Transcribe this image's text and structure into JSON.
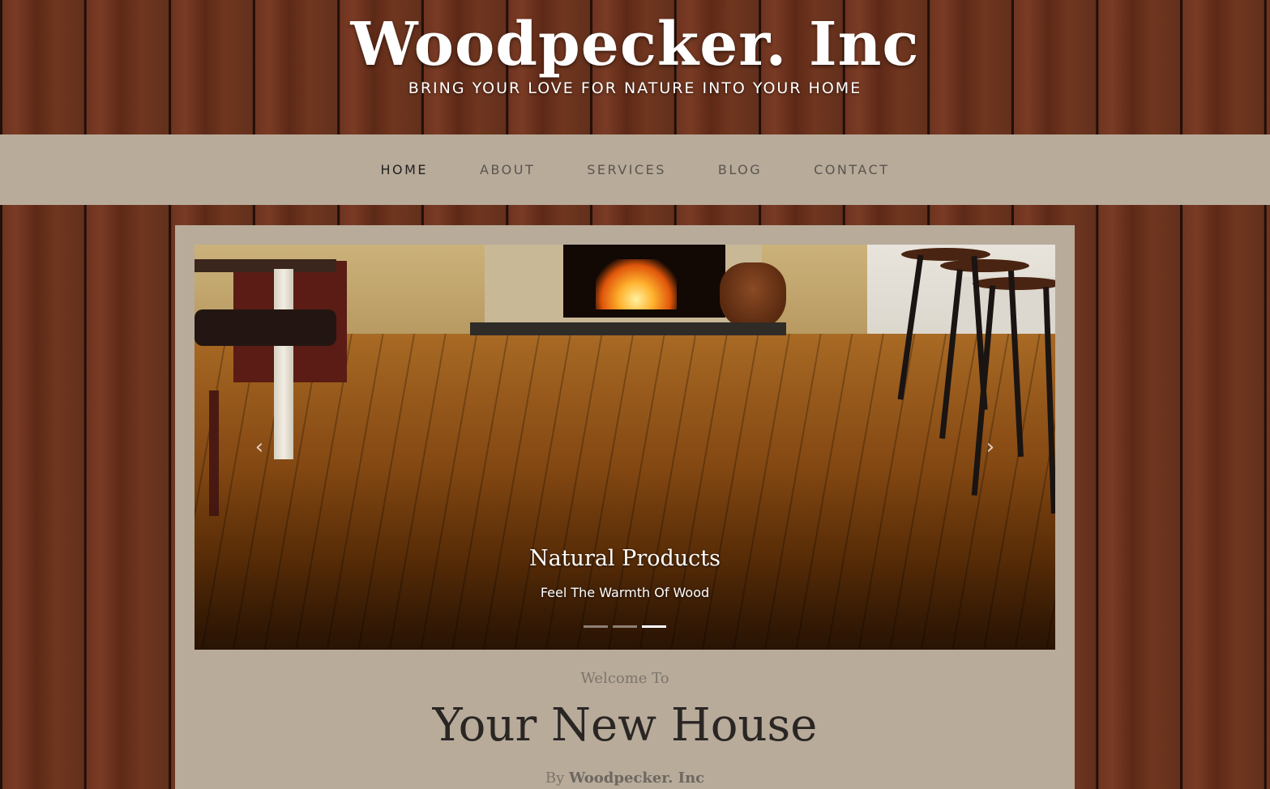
{
  "header": {
    "site_title": "Woodpecker. Inc",
    "tagline": "BRING YOUR LOVE FOR NATURE INTO YOUR HOME"
  },
  "nav": {
    "items": [
      {
        "label": "HOME",
        "active": true
      },
      {
        "label": "ABOUT",
        "active": false
      },
      {
        "label": "SERVICES",
        "active": false
      },
      {
        "label": "BLOG",
        "active": false
      },
      {
        "label": "CONTACT",
        "active": false
      }
    ]
  },
  "carousel": {
    "caption_title": "Natural Products",
    "caption_subtitle": "Feel The Warmth Of Wood",
    "prev_icon": "chevron-left-icon",
    "next_icon": "chevron-right-icon",
    "slide_count": 3,
    "active_index": 2
  },
  "welcome": {
    "pre_title": "Welcome To",
    "title": "Your New House",
    "by_label": "By",
    "by_brand": "Woodpecker. Inc"
  },
  "colors": {
    "panel": "#b8ab9a",
    "nav_active": "#222222",
    "nav_text": "#5a5550",
    "heading": "#2a2624",
    "muted": "#7d756b"
  }
}
